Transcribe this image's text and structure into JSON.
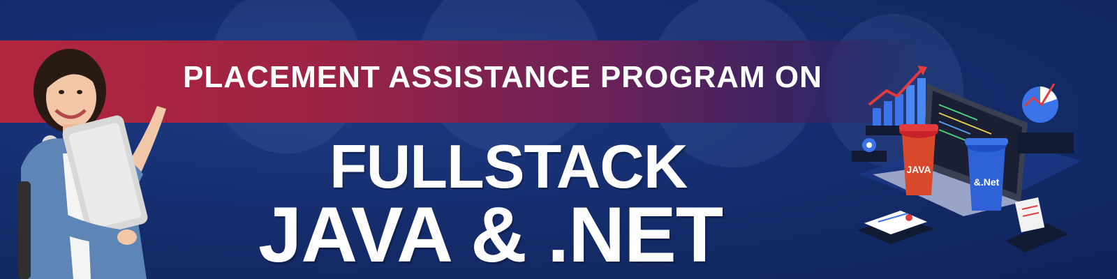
{
  "banner": {
    "subtitle": "PLACEMENT ASSISTANCE PROGRAM ON",
    "title_line1": "FULLSTACK",
    "title_line2": "JAVA & .NET"
  },
  "illustration": {
    "cup_red_label": "JAVA",
    "cup_blue_label": "&.Net"
  },
  "colors": {
    "background": "#132a68",
    "stripe_start": "#b3263e",
    "stripe_end": "#3b2461",
    "text": "#ffffff"
  }
}
